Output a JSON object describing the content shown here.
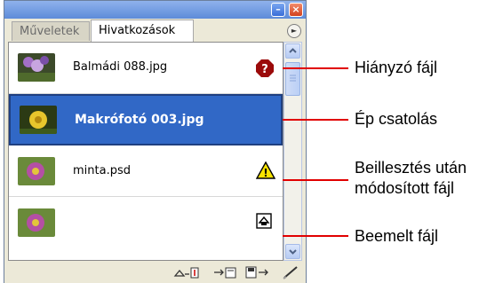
{
  "panel": {
    "tabs": [
      {
        "label": "Műveletek",
        "active": false
      },
      {
        "label": "Hivatkozások",
        "active": true
      }
    ],
    "files": [
      {
        "name": "Balmádi 088.jpg",
        "status": "missing-icon"
      },
      {
        "name": "Makrófotó 003.jpg",
        "status": "none",
        "selected": true
      },
      {
        "name": "minta.psd",
        "status": "modified-warning-icon"
      },
      {
        "name": "",
        "status": "embedded-icon"
      }
    ],
    "toolbar_icons": [
      "embed-icon",
      "relink-icon",
      "goto-link-icon",
      "edit-original-icon"
    ]
  },
  "callouts": [
    {
      "text": "Hiányzó fájl"
    },
    {
      "text": "Ép csatolás"
    },
    {
      "text": "Beillesztés után",
      "text2": "módosított fájl"
    },
    {
      "text": "Beemelt fájl"
    }
  ],
  "colors": {
    "selection": "#3168c6",
    "callout_line": "#e10000",
    "missing_badge": "#9b0a0a",
    "warning_yellow": "#f7e300"
  }
}
